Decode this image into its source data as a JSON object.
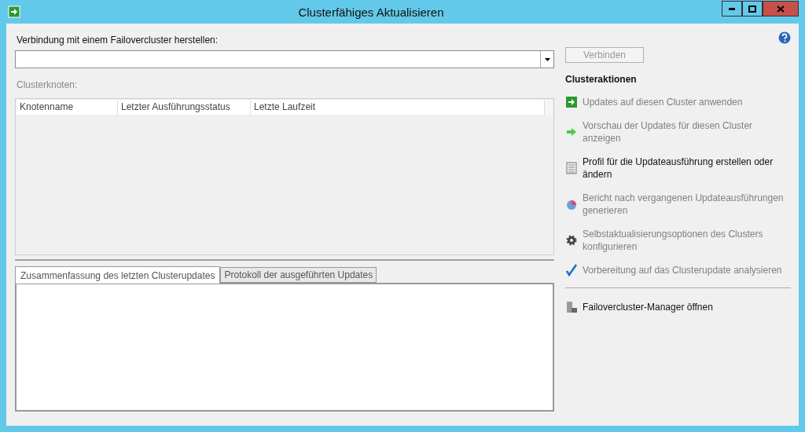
{
  "window": {
    "title": "Clusterfähiges Aktualisieren"
  },
  "connect": {
    "label": "Verbindung mit einem Failovercluster herstellen:",
    "button": {
      "label": "Verbinden",
      "disabled": true
    }
  },
  "nodes": {
    "label": "Clusterknoten:",
    "disabled": true,
    "columns": [
      "Knotenname",
      "Letzter Ausführungsstatus",
      "Letzte Laufzeit"
    ]
  },
  "tabs": [
    {
      "label": "Zusammenfassung des letzten Clusterupdates",
      "selected": true
    },
    {
      "label": "Protokoll der ausgeführten Updates",
      "selected": false
    }
  ],
  "actions": {
    "title": "Clusteraktionen",
    "items": [
      {
        "kind": "apply",
        "label": "Updates auf diesen Cluster anwenden",
        "disabled": true
      },
      {
        "kind": "preview",
        "label": "Vorschau der Updates für diesen Cluster anzeigen",
        "disabled": true
      },
      {
        "kind": "profile",
        "label": "Profil für die Updateausführung erstellen oder ändern",
        "disabled": false
      },
      {
        "kind": "report",
        "label": "Bericht nach vergangenen Updateausführungen generieren",
        "disabled": true
      },
      {
        "kind": "settings",
        "label": "Selbstaktualisierungsoptionen des Clusters konfigurieren",
        "disabled": true
      },
      {
        "kind": "analyze",
        "label": "Vorbereitung auf das Clusterupdate analysieren",
        "disabled": true
      }
    ],
    "extra": [
      {
        "kind": "manager",
        "label": "Failovercluster-Manager öffnen",
        "disabled": false
      }
    ]
  }
}
